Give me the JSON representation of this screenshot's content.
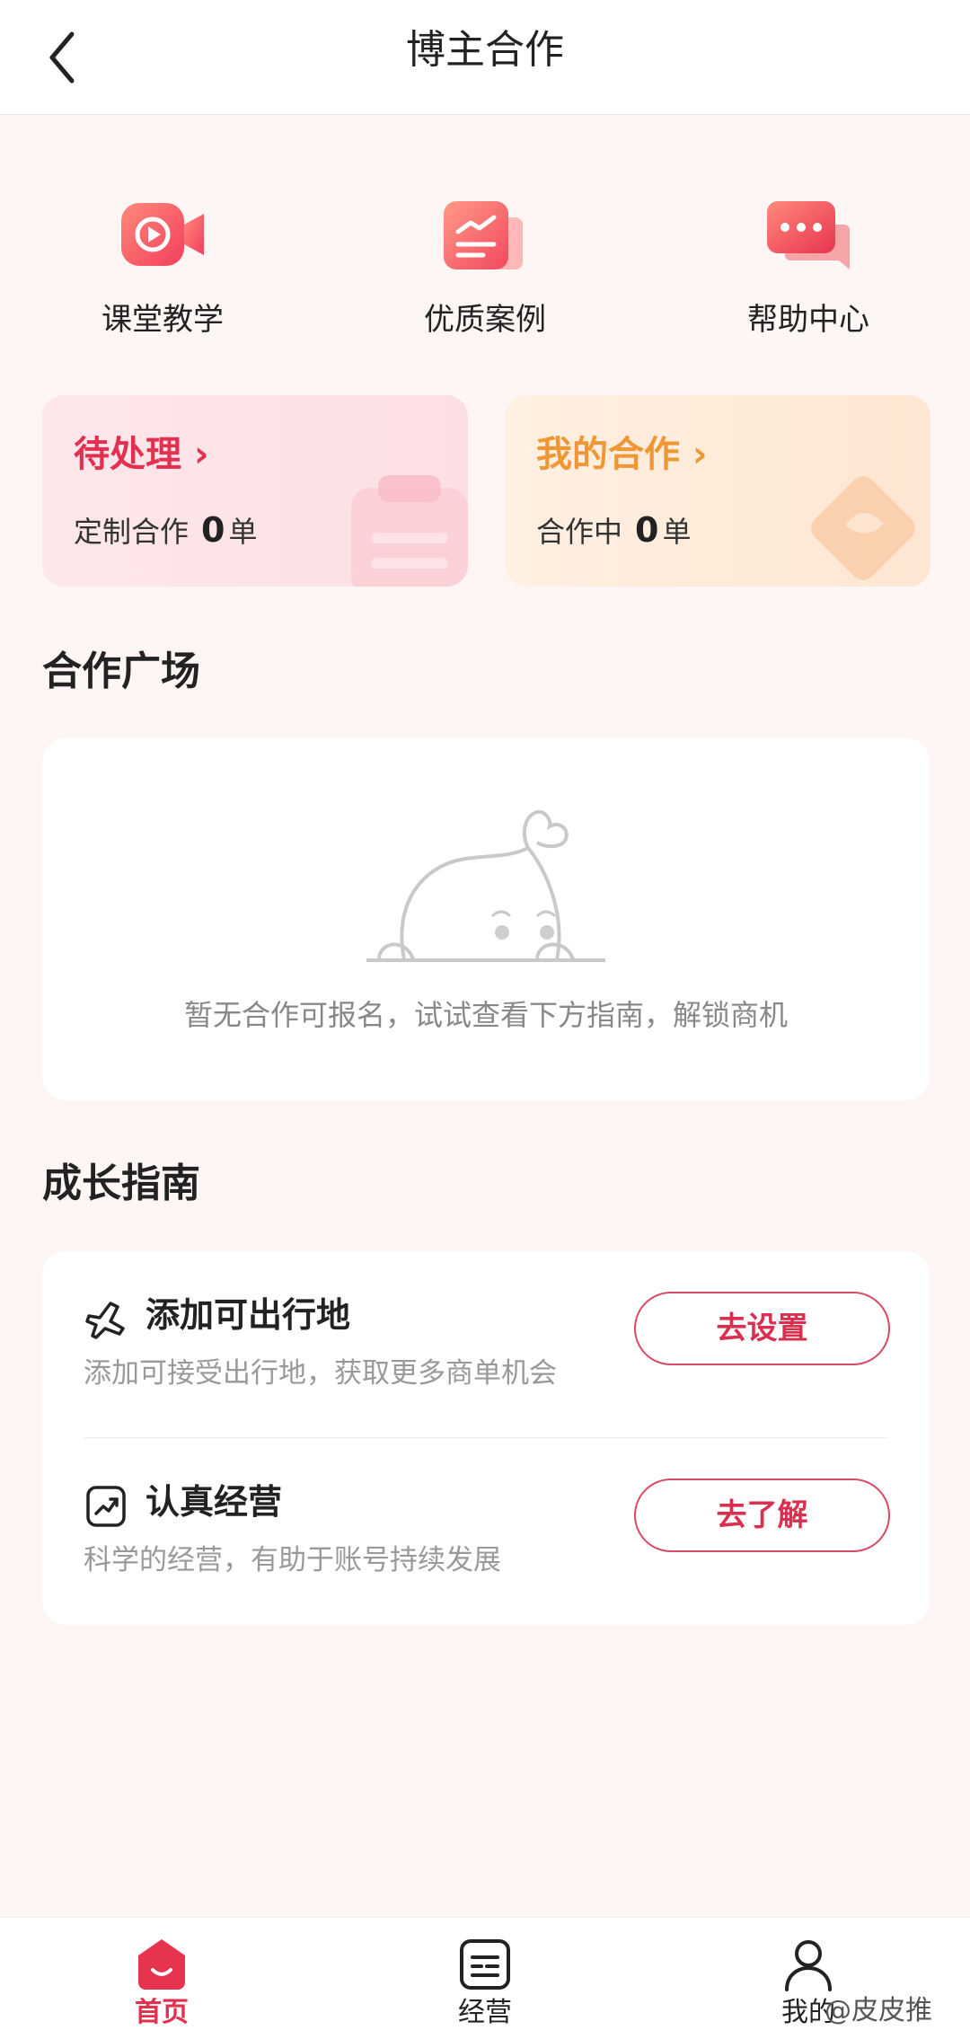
{
  "header": {
    "title": "博主合作"
  },
  "shortcuts": [
    {
      "label": "课堂教学",
      "icon": "video-icon"
    },
    {
      "label": "优质案例",
      "icon": "case-document-icon"
    },
    {
      "label": "帮助中心",
      "icon": "chat-bubble-icon"
    }
  ],
  "cards": {
    "pending": {
      "title": "待处理",
      "sub_label": "定制合作",
      "count": "0",
      "unit": "单"
    },
    "my_coop": {
      "title": "我的合作",
      "sub_label": "合作中",
      "count": "0",
      "unit": "单"
    }
  },
  "plaza": {
    "title": "合作广场",
    "empty_text": "暂无合作可报名，试试查看下方指南，解锁商机"
  },
  "guide": {
    "title": "成长指南",
    "items": [
      {
        "title": "添加可出行地",
        "desc": "添加可接受出行地，获取更多商单机会",
        "button": "去设置",
        "icon": "airplane-icon"
      },
      {
        "title": "认真经营",
        "desc": "科学的经营，有助于账号持续发展",
        "button": "去了解",
        "icon": "trend-chart-icon"
      }
    ]
  },
  "tabbar": {
    "items": [
      {
        "label": "首页",
        "icon": "home-icon",
        "active": true
      },
      {
        "label": "经营",
        "icon": "manage-list-icon",
        "active": false
      },
      {
        "label": "我的",
        "icon": "profile-icon",
        "active": false
      }
    ]
  },
  "watermark": "@皮皮推",
  "colors": {
    "accent_red": "#e23150",
    "accent_orange": "#ef9734",
    "background": "#fdf6f4"
  }
}
